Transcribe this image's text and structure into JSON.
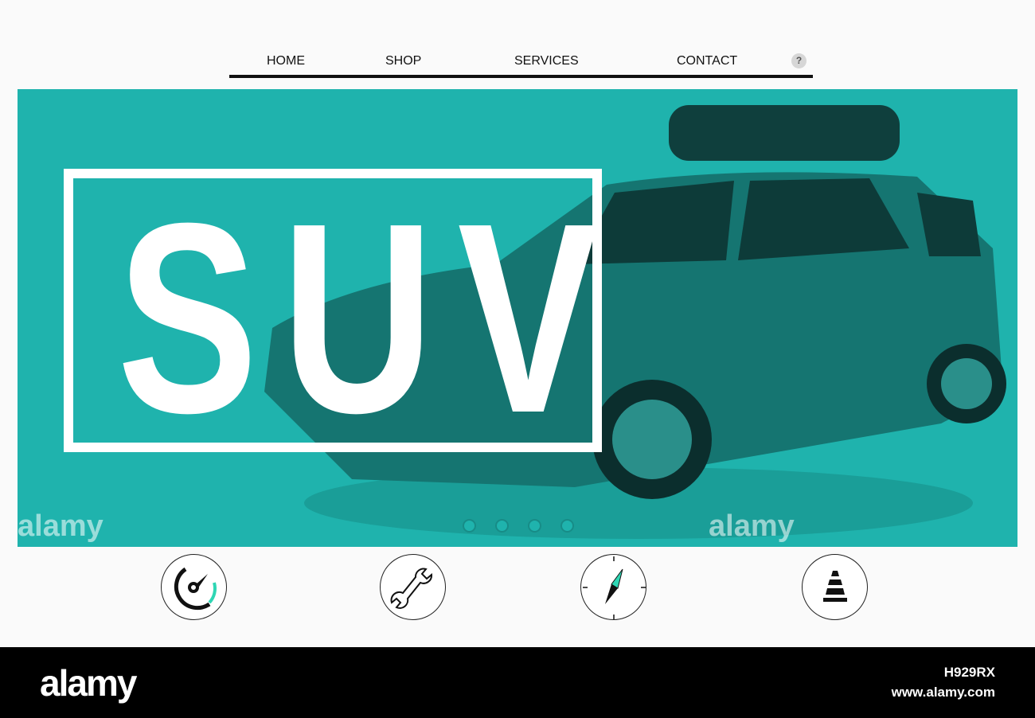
{
  "nav": {
    "items": [
      "HOME",
      "SHOP",
      "SERVICES",
      "CONTACT"
    ],
    "help": "?"
  },
  "hero": {
    "title": "SUV",
    "background": "#1fb3ad",
    "slides": 4,
    "active_slide": 0
  },
  "feature_icons": [
    "speedometer-icon",
    "wrench-icon",
    "compass-icon",
    "traffic-cone-icon"
  ],
  "accent": "#2fd6b4",
  "watermark": "alamy",
  "footer": {
    "logo": "alamy",
    "image_id": "H929RX",
    "url": "www.alamy.com"
  }
}
